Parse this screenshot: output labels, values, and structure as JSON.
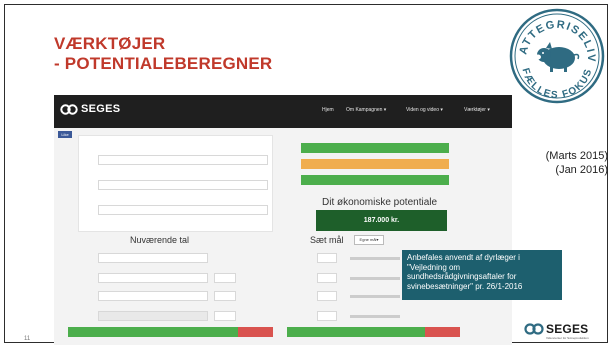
{
  "slide": {
    "title_line1": "VÆRKTØJER",
    "title_line2": "- POTENTIALEBEREGNER",
    "page_number": "11",
    "dates": [
      "(Marts 2015)",
      "(Jan 2016)"
    ]
  },
  "seal": {
    "text_top": "PATTEGRISELIV",
    "text_bottom": "FÆLLES FOKUS"
  },
  "website": {
    "logo": "SEGES",
    "nav": [
      "Hjem",
      "Om Kampagnen ▾",
      "Viden og video ▾",
      "Værktøjer ▾"
    ],
    "facebook": "Like",
    "result_heading": "Dit økonomiske potentiale",
    "result_value": "187.000 kr.",
    "left_heading": "Nuværende tal",
    "right_heading": "Sæt mål",
    "own_button": "Egne mål▾"
  },
  "callout": {
    "lines": [
      "Anbefales anvendt af dyrlæger i",
      "\"Vejledning om",
      "sundhedsrådgivningsaftaler for",
      "svinebesætninger\" pr. 26/1-2016"
    ]
  },
  "footer_logo": {
    "word": "SEGES",
    "subline": "Videncenter for Svineproduktion"
  },
  "colors": {
    "title": "#c0392b",
    "callout": "#1d5f6e",
    "nav": "#1f1f1f",
    "green": "#4cae4c",
    "dark_green": "#1e5f2a",
    "orange": "#f0ad4e",
    "red": "#d9534f"
  }
}
